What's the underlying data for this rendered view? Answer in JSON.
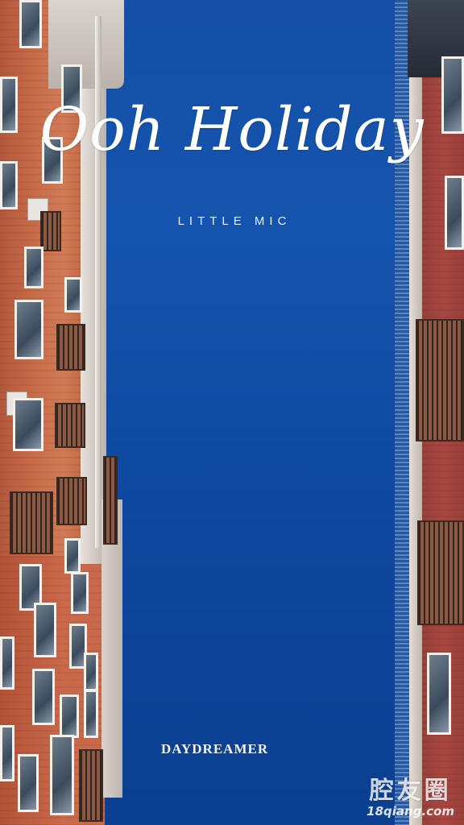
{
  "poster": {
    "title": "Ooh Holiday",
    "subtitle": "LITTLE MIC",
    "footer": "DAYDREAMER"
  },
  "watermark": {
    "main": "腔友圈",
    "sub": "18qiang.com"
  },
  "colors": {
    "sky": "#1554ae",
    "left_building": "#c66a48",
    "right_building": "#a8473f",
    "text": "#ffffff"
  }
}
